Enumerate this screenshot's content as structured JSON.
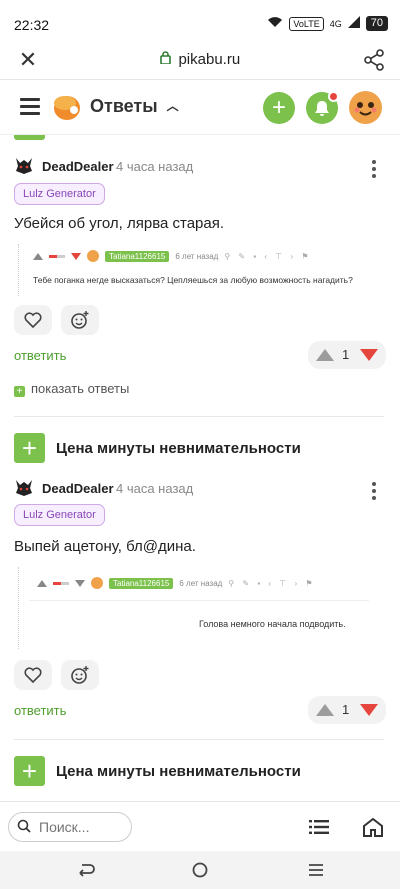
{
  "status_bar": {
    "time": "22:32",
    "volte": "VoLTE",
    "network": "4G",
    "battery": "70"
  },
  "url_bar": {
    "url": "pikabu.ru"
  },
  "header": {
    "section_title": "Ответы"
  },
  "comments": [
    {
      "author": "DeadDealer",
      "time": "4 часа назад",
      "tag": "Lulz Generator",
      "text": "Убейся об угол, лярва старая.",
      "quote": {
        "user": "Tatiana1126615",
        "time": "6 лет назад",
        "text": "Тебе поганка негде высказаться? Цепляешься за любую возможность нагадить?"
      },
      "reply_label": "ответить",
      "rating": "1",
      "show_replies_label": "показать ответы"
    },
    {
      "author": "DeadDealer",
      "time": "4 часа назад",
      "tag": "Lulz Generator",
      "text": "Выпей ацетону, бл@дина.",
      "quote": {
        "user": "Tatiana1126615",
        "time": "6 лет назад",
        "text": "Голова немного начала подводить."
      },
      "reply_label": "ответить",
      "rating": "1"
    }
  ],
  "posts": [
    {
      "title": "Цена минуты невнимательности"
    },
    {
      "title": "Цена минуты невнимательности"
    }
  ],
  "bottom_bar": {
    "search_placeholder": "Поиск..."
  },
  "colors": {
    "accent_green": "#7bc14b",
    "downvote_red": "#e5453c",
    "tag_purple": "#8a46b8"
  }
}
